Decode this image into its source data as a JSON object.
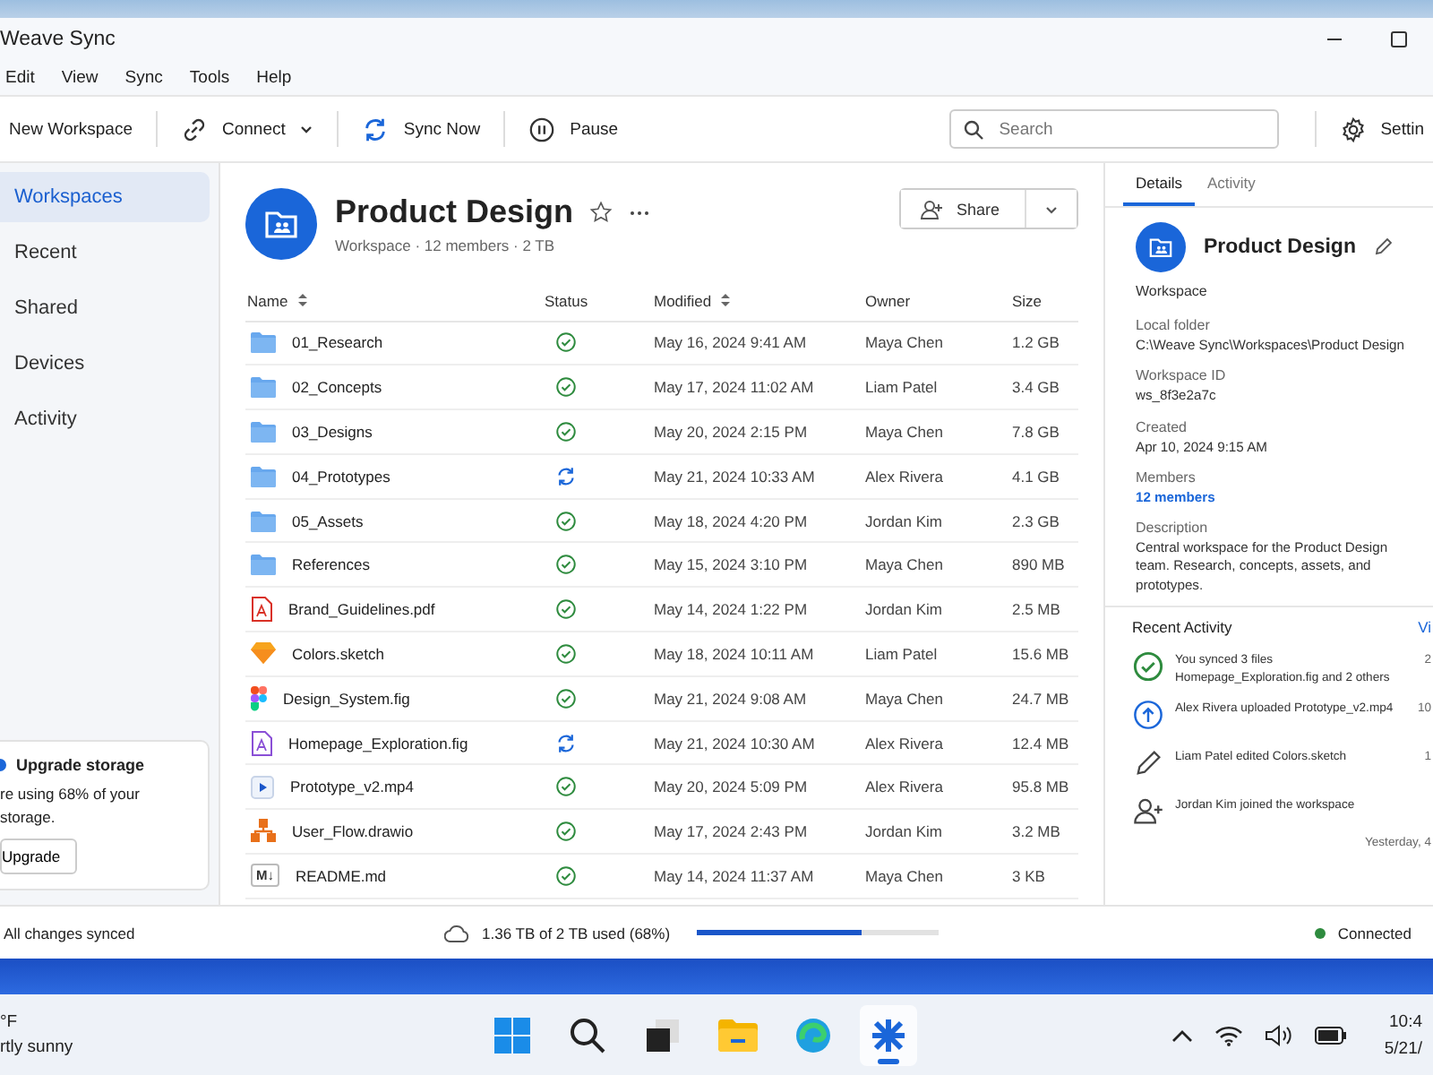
{
  "window": {
    "title": "Weave Sync"
  },
  "menu": [
    "Edit",
    "View",
    "Sync",
    "Tools",
    "Help"
  ],
  "toolbar": {
    "buttons": [
      {
        "kind": "new",
        "label": "New Workspace"
      },
      {
        "kind": "connect",
        "label": "Connect"
      },
      {
        "kind": "sync",
        "label": "Sync Now"
      },
      {
        "kind": "pause",
        "label": "Pause"
      }
    ],
    "search": {
      "placeholder": "Search"
    },
    "settings": "Settin"
  },
  "sidebar": {
    "items": [
      {
        "label": "Workspaces",
        "selected": true
      },
      {
        "label": "Recent",
        "selected": false
      },
      {
        "label": "Shared",
        "selected": false
      },
      {
        "label": "Devices",
        "selected": false
      },
      {
        "label": "Activity",
        "selected": false
      }
    ],
    "upgrade": {
      "title": "Upgrade storage",
      "text": "re using 68% of your",
      "text_2": "storage.",
      "button": "Upgrade"
    }
  },
  "workspace": {
    "title": "Product Design",
    "meta": "Workspace · 12 members · 2 TB",
    "starred": false,
    "share": "Share"
  },
  "table": {
    "columns": [
      {
        "label": "Name",
        "sortable": true
      },
      {
        "label": "Status",
        "sortable": false
      },
      {
        "label": "Modified",
        "sortable": true
      },
      {
        "label": "Owner",
        "sortable": false
      },
      {
        "label": "Size",
        "sortable": false
      }
    ],
    "rows": [
      {
        "kind": "folder",
        "name": "01_Research",
        "syncing": false,
        "modified": "May 16, 2024 9:41 AM",
        "owner": "Maya Chen",
        "size": "1.2 GB"
      },
      {
        "kind": "folder",
        "name": "02_Concepts",
        "syncing": false,
        "modified": "May 17, 2024 11:02 AM",
        "owner": "Liam Patel",
        "size": "3.4 GB"
      },
      {
        "kind": "folder",
        "name": "03_Designs",
        "syncing": false,
        "modified": "May 20, 2024 2:15 PM",
        "owner": "Maya Chen",
        "size": "7.8 GB"
      },
      {
        "kind": "folder",
        "name": "04_Prototypes",
        "syncing": true,
        "modified": "May 21, 2024 10:33 AM",
        "owner": "Alex Rivera",
        "size": "4.1 GB"
      },
      {
        "kind": "folder",
        "name": "05_Assets",
        "syncing": false,
        "modified": "May 18, 2024 4:20 PM",
        "owner": "Jordan Kim",
        "size": "2.3 GB"
      },
      {
        "kind": "folder",
        "name": "References",
        "syncing": false,
        "modified": "May 15, 2024 3:10 PM",
        "owner": "Maya Chen",
        "size": "890 MB"
      },
      {
        "kind": "pdf",
        "name": "Brand_Guidelines.pdf",
        "syncing": false,
        "modified": "May 14, 2024 1:22 PM",
        "owner": "Jordan Kim",
        "size": "2.5 MB"
      },
      {
        "kind": "sketch",
        "name": "Colors.sketch",
        "syncing": false,
        "modified": "May 18, 2024 10:11 AM",
        "owner": "Liam Patel",
        "size": "15.6 MB"
      },
      {
        "kind": "figma",
        "name": "Design_System.fig",
        "syncing": false,
        "modified": "May 21, 2024 9:08 AM",
        "owner": "Maya Chen",
        "size": "24.7 MB"
      },
      {
        "kind": "document",
        "name": "Homepage_Exploration.fig",
        "syncing": true,
        "modified": "May 21, 2024 10:30 AM",
        "owner": "Alex Rivera",
        "size": "12.4 MB"
      },
      {
        "kind": "video",
        "name": "Prototype_v2.mp4",
        "syncing": false,
        "modified": "May 20, 2024 5:09 PM",
        "owner": "Alex Rivera",
        "size": "95.8 MB"
      },
      {
        "kind": "diagram",
        "name": "User_Flow.drawio",
        "syncing": false,
        "modified": "May 17, 2024 2:43 PM",
        "owner": "Jordan Kim",
        "size": "3.2 MB"
      },
      {
        "kind": "markdown",
        "name": "README.md",
        "syncing": false,
        "modified": "May 14, 2024 11:37 AM",
        "owner": "Maya Chen",
        "size": "3 KB",
        "badge": "M↓"
      }
    ]
  },
  "details": {
    "tabs": [
      {
        "label": "Details",
        "selected": true
      },
      {
        "label": "Activity",
        "selected": false
      }
    ],
    "title": "Product Design",
    "type": "Workspace",
    "fields": [
      {
        "label": "Local folder",
        "value": "C:\\Weave Sync\\Workspaces\\Product Design",
        "link": false
      },
      {
        "label": "Workspace ID",
        "value": "ws_8f3e2a7c",
        "link": false
      },
      {
        "label": "Created",
        "value": "Apr 10, 2024 9:15 AM",
        "link": false
      },
      {
        "label": "Members",
        "value": "12 members",
        "link": true
      },
      {
        "label": "Description",
        "value": "Central workspace for the Product Design team. Research, concepts, assets, and prototypes.",
        "link": false
      }
    ],
    "recent": {
      "title": "Recent Activity",
      "link": "Vi",
      "items": [
        {
          "kind": "synced",
          "text": "You synced 3 files",
          "subtext": "Homepage_Exploration.fig and 2 others",
          "time": "2"
        },
        {
          "kind": "upload",
          "text": "Alex Rivera uploaded Prototype_v2.mp4",
          "time": "10"
        },
        {
          "kind": "edit",
          "text": "Liam Patel edited Colors.sketch",
          "time": "1"
        },
        {
          "kind": "join",
          "text": "Jordan Kim joined the workspace",
          "time": "Yesterday, 4"
        }
      ]
    }
  },
  "status_bar": {
    "sync": "All changes synced",
    "storage": "1.36 TB of 2 TB used (68%)",
    "level": 0.68,
    "connection": "Connected",
    "connected": true
  },
  "taskbar": {
    "weather": {
      "temp": "°F",
      "text": "rtly sunny"
    },
    "apps": [
      {
        "kind": "start",
        "selected": false
      },
      {
        "kind": "search",
        "selected": false
      },
      {
        "kind": "taskview",
        "selected": false
      },
      {
        "kind": "explorer",
        "selected": false
      },
      {
        "kind": "browser",
        "selected": false
      },
      {
        "kind": "weave",
        "selected": true
      }
    ],
    "clock": {
      "time": "10:4",
      "date": "5/21/"
    }
  }
}
